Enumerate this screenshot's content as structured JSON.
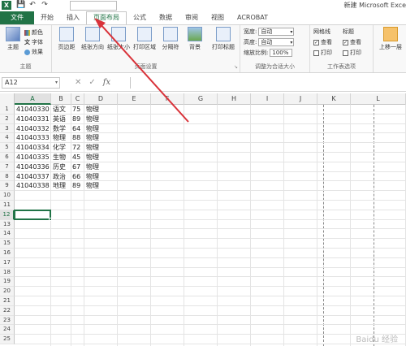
{
  "titlebar": {
    "app_logo": "X",
    "doc_title": "新建 Microsoft Exce",
    "qat": [
      "save-icon",
      "undo-icon",
      "redo-icon"
    ]
  },
  "tabs": {
    "file": "文件",
    "items": [
      "开始",
      "插入",
      "页面布局",
      "公式",
      "数据",
      "审阅",
      "视图",
      "ACROBAT"
    ],
    "active_index": 2
  },
  "ribbon": {
    "themes": {
      "label": "主题",
      "theme_btn": "主题",
      "colors": "颜色",
      "fonts": "字体",
      "effects": "效果"
    },
    "page_setup": {
      "label": "页面设置",
      "buttons": [
        "页边距",
        "纸张方向",
        "纸张大小",
        "打印区域",
        "分隔符",
        "背景",
        "打印标题"
      ]
    },
    "scale_to_fit": {
      "label": "调整为合适大小",
      "width_label": "宽度:",
      "width_value": "自动",
      "height_label": "高度:",
      "height_value": "自动",
      "scale_label": "缩放比例:",
      "scale_value": "100%"
    },
    "sheet_options": {
      "label": "工作表选项",
      "gridlines": "网格线",
      "headings": "标题",
      "view": "查看",
      "print": "打印",
      "gridlines_view": true,
      "gridlines_print": false,
      "headings_view": true,
      "headings_print": false
    },
    "arrange": {
      "bring_forward": "上移一层"
    }
  },
  "formula_bar": {
    "name_box": "A12",
    "fx": "fx",
    "value": ""
  },
  "grid": {
    "columns": [
      "A",
      "B",
      "C",
      "D",
      "E",
      "F",
      "G",
      "H",
      "I",
      "J",
      "K",
      "L"
    ],
    "rows": [
      "1",
      "2",
      "3",
      "4",
      "5",
      "6",
      "7",
      "8",
      "9",
      "10",
      "11",
      "12",
      "13",
      "14",
      "15",
      "16",
      "17",
      "18",
      "19",
      "20",
      "21",
      "22",
      "23",
      "24",
      "25"
    ],
    "selected_cell": "A12",
    "data": [
      [
        "41040330",
        "语文",
        "75",
        "物理"
      ],
      [
        "41040331",
        "英语",
        "89",
        "物理"
      ],
      [
        "41040332",
        "数学",
        "64",
        "物理"
      ],
      [
        "41040333",
        "物理",
        "88",
        "物理"
      ],
      [
        "41040334",
        "化学",
        "72",
        "物理"
      ],
      [
        "41040335",
        "生物",
        "45",
        "物理"
      ],
      [
        "41040336",
        "历史",
        "67",
        "物理"
      ],
      [
        "41040337",
        "政治",
        "66",
        "物理"
      ],
      [
        "41040338",
        "地理",
        "89",
        "物理"
      ]
    ]
  },
  "watermark": "Baidu 经验"
}
